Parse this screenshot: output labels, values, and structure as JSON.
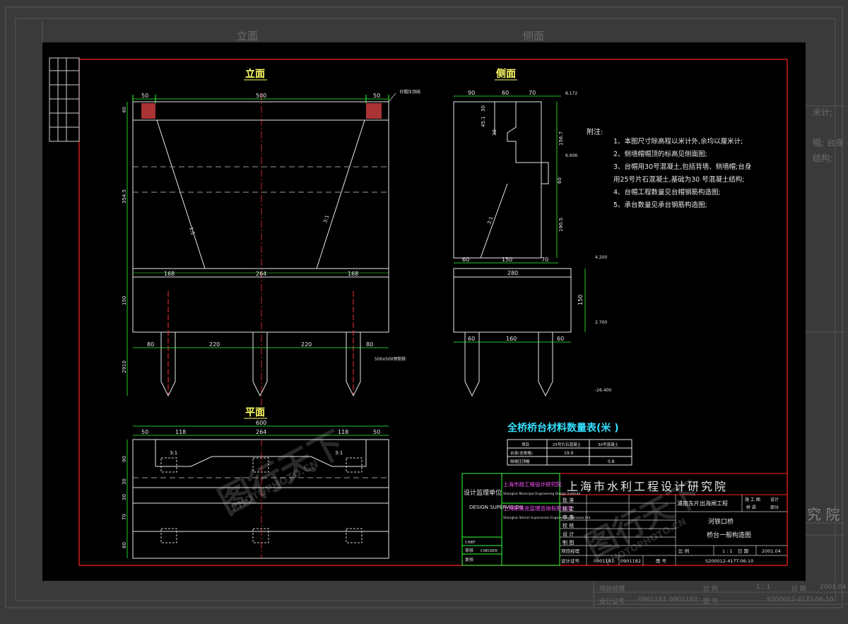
{
  "background": {
    "label_elevation": "立面",
    "label_side": "侧面",
    "label_notes_frag1": "米计;",
    "label_notes_frag2": "帽; 台身",
    "label_notes_frag3": "结构;",
    "institute_frag": "究 院",
    "row_labels": [
      "项目经理",
      "设计证号",
      "0901181",
      "0901182",
      "图 号",
      "S200012-417T-06-10",
      "比 例",
      "1 : 1",
      "日 期",
      "2001.04"
    ]
  },
  "views": {
    "elevation_title": "立面",
    "side_title": "侧面",
    "plan_title": "平面"
  },
  "elevation": {
    "top_dims": [
      "50",
      "500",
      "50"
    ],
    "cap_note": "台帽压顶线",
    "left_dims": [
      "40",
      "354.5",
      "150",
      "2910"
    ],
    "slope_left": "1:1",
    "slope_right": "3:1",
    "mid_dims": [
      "168",
      "264",
      "168"
    ],
    "pile_dims": [
      "80",
      "220",
      "220",
      "80"
    ],
    "pile_note": "500x500预制桩"
  },
  "side": {
    "top_dims": [
      "90",
      "60",
      "70"
    ],
    "elev_top": "8.172",
    "dims_inner": [
      "30",
      "45.1",
      "30"
    ],
    "dim_1567": "156.7",
    "elev_6606": "6.606",
    "dim_60": "60",
    "slope": "3:1",
    "dim_1905": "190.5",
    "base_dims": [
      "60",
      "150",
      "70"
    ],
    "base_width": "280",
    "elev_4200": "4.200",
    "dim_150": "150",
    "elev_2700": "2.700",
    "pile_dims": [
      "60",
      "160",
      "60"
    ],
    "elev_bottom": "-26.400"
  },
  "plan": {
    "top_dims_a": [
      "50",
      "118",
      "264",
      "118",
      "50"
    ],
    "total": "600",
    "slope_left": "3:1",
    "slope_right": "3:1",
    "left_dims": [
      "90",
      "30",
      "30",
      "70",
      "60"
    ]
  },
  "notes": {
    "heading": "附注:",
    "items": [
      "1、本图尺寸除高程以米计外,余均以厘米计;",
      "2、侧墙帽帽顶的标高见侧面图;",
      "3、台帽用30号混凝土,包括背墙、侧墙帽;台身",
      "用25号片石混凝土,基础为30 号混凝土结构;",
      "4、台帽工程数量见台帽钢筋构造图;",
      "5、承台数量见承台钢筋构造图;"
    ]
  },
  "quantity_table": {
    "title": "全桥桥台材料数量表(米 )",
    "headers": [
      "项目",
      "25号片石混凝土",
      "30号混凝土"
    ],
    "rows": [
      [
        "台身(含侧墙)",
        "19.9",
        ""
      ],
      [
        "侧墙压顶帽",
        "",
        "0.8"
      ]
    ]
  },
  "title_block": {
    "institute": "上海市水利工程设计研究院",
    "supervision_label": "设计监理单位",
    "supervision_en": "DESIGN SUPERVISION",
    "org1_cn": "上海市政工程设计研究院",
    "org1_en": "Shanghai Municipal Engineering Design Institute",
    "org2_cn": "上海斯美克监理咨询有限公司",
    "org2_en": "Shanghai Shimei Supervision Engineering Services Ltd.",
    "left_small": [
      "CHIEF",
      "审核",
      "CHECKER",
      "复核"
    ],
    "roles": [
      "批 准",
      "核 定",
      "审 查",
      "校 核",
      "设 计",
      "制 图"
    ],
    "project": "浦南东片出海闸工程",
    "stage": "施 工 图",
    "discipline": "设计",
    "part": "桥 梁",
    "part2": "部分",
    "bridge": "河铁口桥",
    "drawing_name": "桥台一般构造图",
    "row_labels": [
      "项目经理",
      "比 例",
      "1 : 1",
      "日 期",
      "2001.04"
    ],
    "row2": [
      "设计证号",
      "0901181",
      "0901182",
      "图 号",
      "S200012-417T-06-10"
    ]
  },
  "watermark": {
    "logo": "图行天下",
    "text": "PHOTOPHOTO.CN"
  },
  "colors": {
    "frame": "#ff2222",
    "green": "#33ff33",
    "white": "#e8e8e8",
    "yellow": "#ffff66",
    "cyan": "#33e0ff",
    "magenta": "#ff55ff",
    "centerline": "#ff3333"
  }
}
